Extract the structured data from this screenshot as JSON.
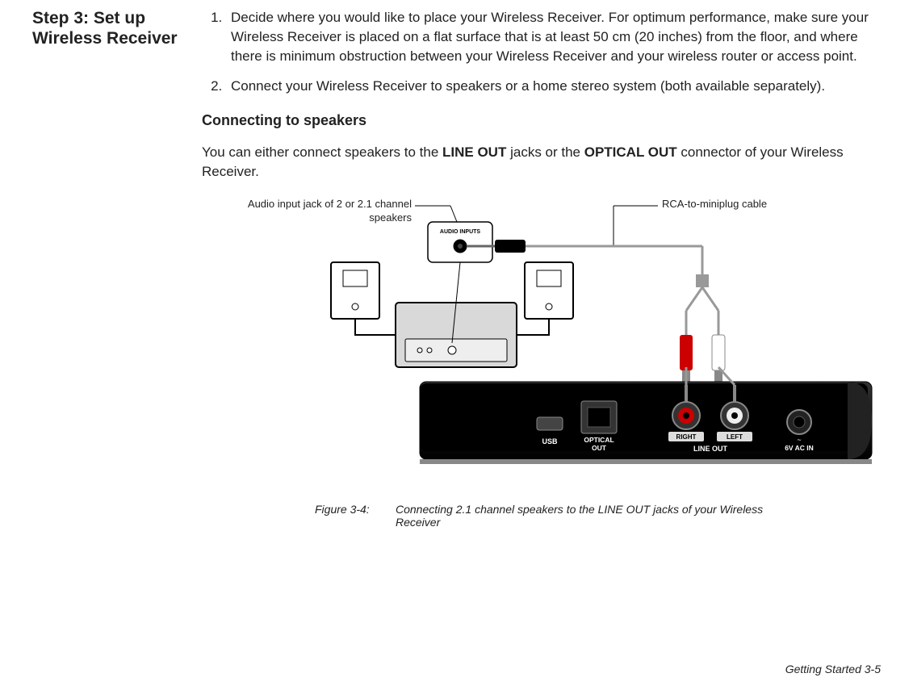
{
  "heading": "Step 3: Set up Wireless Receiver",
  "steps": [
    "Decide where you would like to place your Wireless Receiver. For optimum performance, make sure your Wireless Receiver is placed on a flat surface that is at least 50 cm (20 inches) from the floor, and where there is minimum obstruction between your Wireless Receiver and your wireless router or access point.",
    "Connect your Wireless Receiver to speakers or a home stereo system (both available separately)."
  ],
  "section_heading": "Connecting to speakers",
  "section_para_prefix": "You can either connect speakers to the ",
  "section_para_bold1": "LINE OUT",
  "section_para_mid": " jacks or the ",
  "section_para_bold2": "OPTICAL OUT",
  "section_para_suffix": " connector of your Wireless Receiver.",
  "callouts": {
    "left": "Audio input jack of 2 or 2.1 channel speakers",
    "right": "RCA-to-miniplug cable"
  },
  "device_labels": {
    "audio_inputs": "AUDIO INPUTS",
    "usb": "USB",
    "optical_out": "OPTICAL OUT",
    "right": "RIGHT",
    "left": "LEFT",
    "line_out": "LINE OUT",
    "power": "6V AC IN",
    "tilde": "~"
  },
  "figure": {
    "number": "Figure 3-4:",
    "caption": "Connecting 2.1 channel speakers to the LINE OUT jacks of your Wireless Receiver"
  },
  "footer": "Getting Started  3-5"
}
